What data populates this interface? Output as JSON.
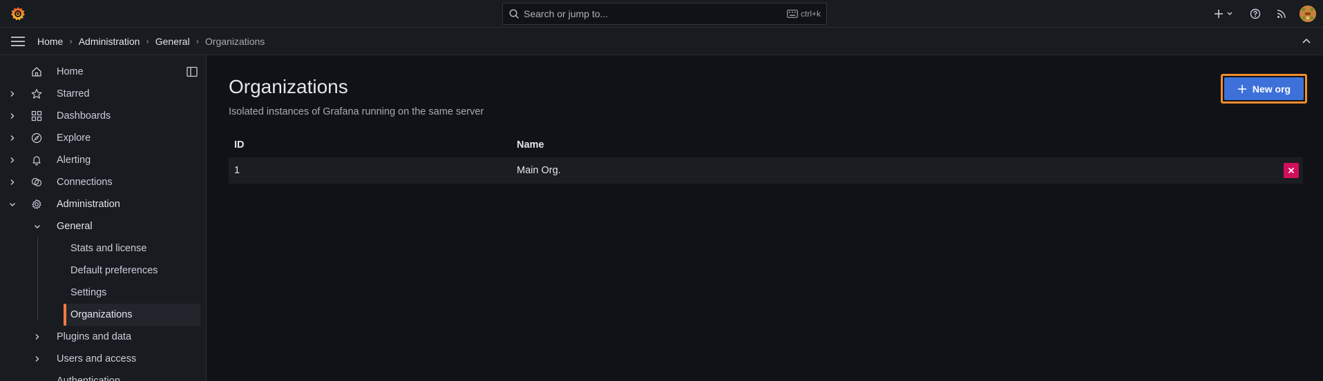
{
  "topbar": {
    "search_placeholder": "Search or jump to...",
    "search_shortcut": "ctrl+k",
    "icons": [
      "grafana-logo-icon",
      "plus-icon",
      "chevron-down-icon",
      "help-icon",
      "rss-icon",
      "avatar"
    ]
  },
  "breadcrumb": [
    {
      "label": "Home"
    },
    {
      "label": "Administration"
    },
    {
      "label": "General"
    },
    {
      "label": "Organizations"
    }
  ],
  "sidebar": {
    "items": [
      {
        "label": "Home",
        "icon": "home-icon"
      },
      {
        "label": "Starred",
        "icon": "star-icon"
      },
      {
        "label": "Dashboards",
        "icon": "apps-icon"
      },
      {
        "label": "Explore",
        "icon": "compass-icon"
      },
      {
        "label": "Alerting",
        "icon": "bell-icon"
      },
      {
        "label": "Connections",
        "icon": "connections-icon"
      },
      {
        "label": "Administration",
        "icon": "cog-icon"
      }
    ],
    "admin_children": [
      {
        "label": "General"
      },
      {
        "label": "Plugins and data"
      },
      {
        "label": "Users and access"
      },
      {
        "label": "Authentication"
      }
    ],
    "general_children": [
      {
        "label": "Stats and license"
      },
      {
        "label": "Default preferences"
      },
      {
        "label": "Settings"
      },
      {
        "label": "Organizations"
      }
    ]
  },
  "page": {
    "title": "Organizations",
    "subtitle": "Isolated instances of Grafana running on the same server",
    "new_button": "New org"
  },
  "table": {
    "columns": [
      "ID",
      "Name"
    ],
    "rows": [
      {
        "id": "1",
        "name": "Main Org."
      }
    ]
  },
  "colors": {
    "accent": "#ff7941",
    "primary_button": "#3d71d9",
    "delete_button": "#d10e5c",
    "highlight_outline": "#f28d2c"
  }
}
